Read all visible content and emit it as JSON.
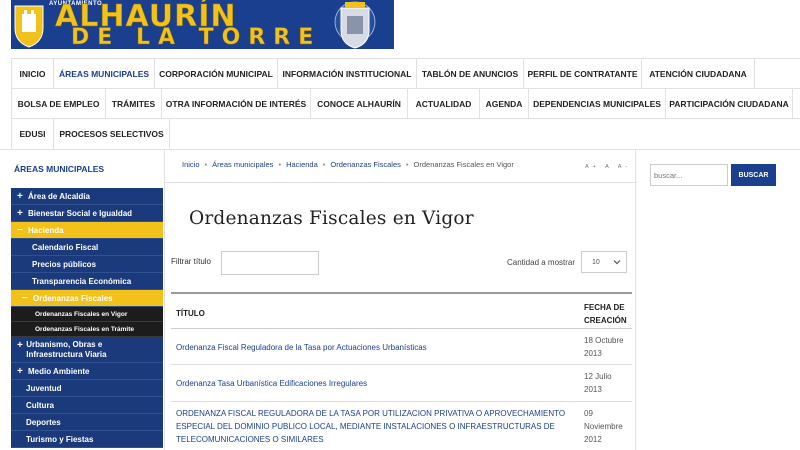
{
  "header": {
    "top_small": "AYUNTAMIENTO",
    "title_line1": "ALHAURÍN",
    "title_line2": "DE LA TORRE"
  },
  "nav": {
    "rows": [
      [
        "INICIO",
        "ÁREAS MUNICIPALES",
        "CORPORACIÓN MUNICIPAL",
        "INFORMACIÓN INSTITUCIONAL",
        "TABLÓN DE ANUNCIOS",
        "PERFIL DE CONTRATANTE",
        "ATENCIÓN CIUDADANA"
      ],
      [
        "BOLSA DE EMPLEO",
        "TRÁMITES",
        "OTRA INFORMACIÓN DE INTERÉS",
        "CONOCE ALHAURÍN",
        "ACTUALIDAD",
        "AGENDA",
        "DEPENDENCIAS MUNICIPALES",
        "PARTICIPACIÓN CIUDADANA"
      ],
      [
        "EDUSI",
        "PROCESOS SELECTIVOS"
      ]
    ],
    "active": "ÁREAS MUNICIPALES"
  },
  "sidebar": {
    "title": "ÁREAS MUNICIPALES",
    "items": [
      {
        "label": "Área de Alcaldía",
        "marker": "+"
      },
      {
        "label": "Bienestar Social e Igualdad",
        "marker": "+"
      },
      {
        "label": "Hacienda",
        "marker": "−"
      },
      {
        "label": "Calendario Fiscal",
        "marker": ""
      },
      {
        "label": "Precios públicos",
        "marker": ""
      },
      {
        "label": "Transparencia Económica",
        "marker": ""
      },
      {
        "label": "Ordenanzas Fiscales",
        "marker": "−"
      },
      {
        "label": "Ordenanzas Fiscales en Vigor",
        "marker": ""
      },
      {
        "label": "Ordenanzas Fiscales en Trámite",
        "marker": ""
      },
      {
        "label": "Urbanismo, Obras e Infraestructura Viaria",
        "marker": "+"
      },
      {
        "label": "Medio Ambiente",
        "marker": "+"
      },
      {
        "label": "Juventud",
        "marker": ""
      },
      {
        "label": "Cultura",
        "marker": ""
      },
      {
        "label": "Deportes",
        "marker": ""
      },
      {
        "label": "Turismo y Fiestas",
        "marker": ""
      }
    ]
  },
  "breadcrumb": {
    "items": [
      "Inicio",
      "Áreas municipales",
      "Hacienda",
      "Ordenanzas Fiscales",
      "Ordenanzas Fiscales en Vigor"
    ],
    "separator": "•"
  },
  "font_controls": "A+ A A-",
  "page_title": "Ordenanzas Fiscales en Vigor",
  "filter": {
    "label": "Filtrar título",
    "value": ""
  },
  "display_count": {
    "label": "Cantidad a mostrar",
    "selected": "10"
  },
  "table": {
    "col_title": "TÍTULO",
    "col_date_l1": "FECHA DE",
    "col_date_l2": "CREACIÓN",
    "rows": [
      {
        "title": "Ordenanza Fiscal Reguladora de la Tasa por Actuaciones Urbanísticas",
        "date_l1": "18 Octubre",
        "date_l2": "2013"
      },
      {
        "title": "Ordenanza Tasa Urbanística Edificaciones Irregulares",
        "date_l1": "12 Julio",
        "date_l2": "2013"
      },
      {
        "title": "ORDENANZA FISCAL REGULADORA DE LA TASA POR UTILIZACION PRIVATIVA O APROVECHAMIENTO ESPECIAL DEL DOMINIO PUBLICO LOCAL, MEDIANTE INSTALACIONES O INFRAESTRUCTURAS DE TELECOMUNICACIONES O SIMILARES",
        "date_l1": "09",
        "date_l2": "Noviembre",
        "date_l3": "2012"
      }
    ]
  },
  "search": {
    "placeholder": "buscar...",
    "button": "BUSCAR"
  },
  "colors": {
    "brand_blue": "#1a3f8f",
    "accent_yellow": "#f2c21b"
  }
}
